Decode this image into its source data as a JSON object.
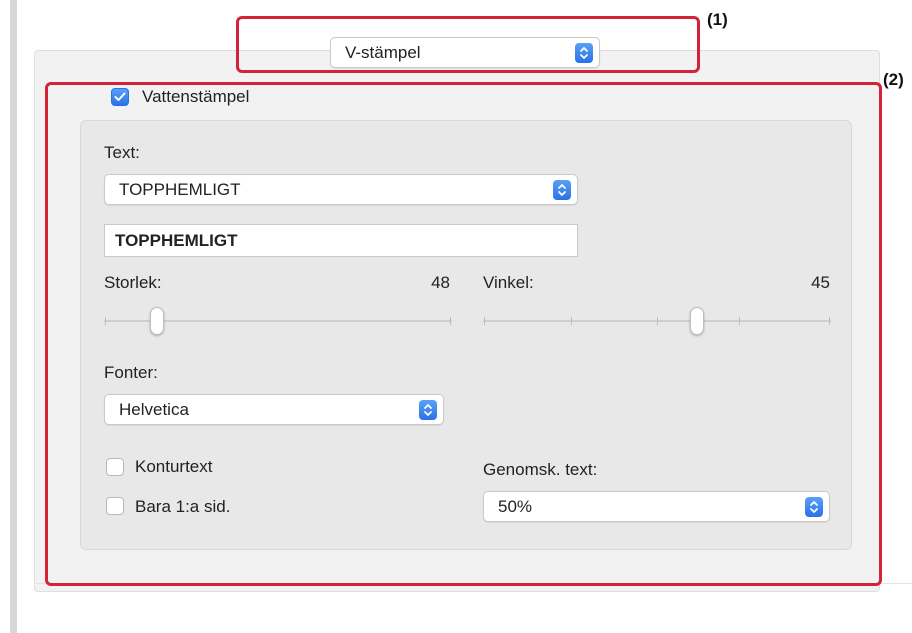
{
  "header_popup": {
    "value": "V-stämpel"
  },
  "watermark": {
    "checkbox_label": "Vattenstämpel",
    "checked": true
  },
  "text": {
    "label": "Text:",
    "popup_value": "TOPPHEMLIGT",
    "field_value": "TOPPHEMLIGT"
  },
  "size": {
    "label": "Storlek:",
    "value": "48"
  },
  "angle": {
    "label": "Vinkel:",
    "value": "45"
  },
  "font": {
    "label": "Fonter:",
    "popup_value": "Helvetica"
  },
  "outline": {
    "label": "Konturtext",
    "checked": false
  },
  "first_page": {
    "label": "Bara 1:a sid.",
    "checked": false
  },
  "transparency": {
    "label": "Genomsk. text:",
    "popup_value": "50%"
  },
  "annotations": {
    "label_1": "(1)",
    "label_2": "(2)",
    "color": "#d3233a"
  },
  "colors": {
    "accent": "#2a72e6"
  }
}
